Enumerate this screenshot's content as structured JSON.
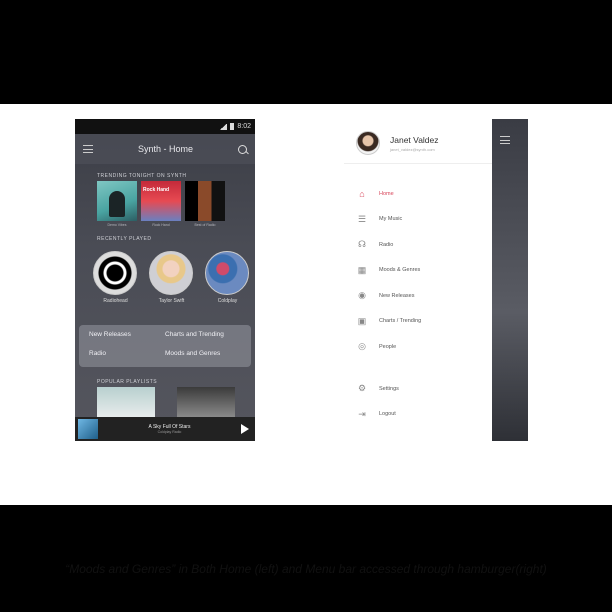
{
  "left_phone": {
    "status_time": "8:02",
    "app_title": "Synth - Home",
    "trending_label": "TRENDING TONIGHT ON SYNTH",
    "trending": [
      {
        "caption": "Demo Vibes"
      },
      {
        "caption": "Rock Hand"
      },
      {
        "caption": "Best of Radio"
      }
    ],
    "cover_text_2": "Rock Hand",
    "recent_label": "RECENTLY PLAYED",
    "artists": [
      {
        "name": "Radiohead"
      },
      {
        "name": "Taylor Swift"
      },
      {
        "name": "Coldplay"
      }
    ],
    "nav_card": {
      "new_releases": "New Releases",
      "charts": "Charts and Trending",
      "radio": "Radio",
      "moods": "Moods and Genres"
    },
    "popular_label": "POPULAR PLAYLISTS",
    "mini_player": {
      "title": "A Sky Full Of Stars",
      "subtitle": "Coldplay Radio"
    }
  },
  "right_phone": {
    "user_name": "Janet Valdez",
    "user_email": "janet_valdez@synth.com",
    "menu_items": [
      {
        "label": "Home",
        "icon": "home-icon",
        "glyph": "⌂",
        "active": true
      },
      {
        "label": "My Music",
        "icon": "list-icon",
        "glyph": "☰",
        "active": false
      },
      {
        "label": "Radio",
        "icon": "headphones-icon",
        "glyph": "☊",
        "active": false
      },
      {
        "label": "Moods & Genres",
        "icon": "grid-icon",
        "glyph": "▦",
        "active": false
      },
      {
        "label": "New Releases",
        "icon": "new-badge-icon",
        "glyph": "◉",
        "active": false
      },
      {
        "label": "Charts / Trending",
        "icon": "chart-icon",
        "glyph": "▣",
        "active": false
      },
      {
        "label": "People",
        "icon": "person-icon",
        "glyph": "◎",
        "active": false
      }
    ],
    "bottom_items": [
      {
        "label": "Settings",
        "icon": "gear-icon",
        "glyph": "⚙"
      },
      {
        "label": "Logout",
        "icon": "logout-icon",
        "glyph": "⇥"
      }
    ]
  },
  "caption": "“Moods and Genres” in Both Home (left) and Menu bar accessed through hamburger(right)",
  "colors": {
    "accent": "#d8455a",
    "slide_bg": "#ffffff",
    "frame_bg": "#000000"
  }
}
